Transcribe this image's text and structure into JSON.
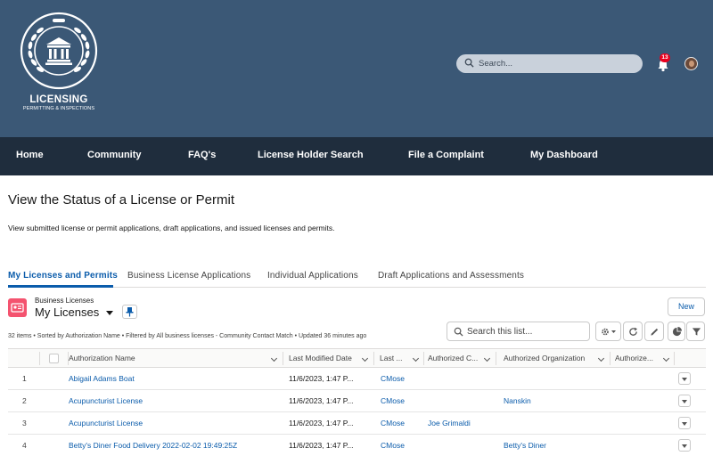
{
  "branding": {
    "title": "LICENSING",
    "subtitle": "PERMITTING & INSPECTIONS"
  },
  "header": {
    "search_placeholder": "Search...",
    "notification_count": "13"
  },
  "nav": {
    "items": [
      "Home",
      "Community",
      "FAQ's",
      "License Holder Search",
      "File a Complaint",
      "My Dashboard"
    ]
  },
  "page": {
    "title": "View the Status of a License or Permit",
    "description": "View submitted license or permit applications, draft applications, and issued licenses and permits."
  },
  "tabs": [
    "My Licenses and Permits",
    "Business License Applications",
    "Individual Applications",
    "Draft Applications and Assessments"
  ],
  "list_view": {
    "object_label": "Business Licenses",
    "name": "My Licenses",
    "new_label": "New",
    "meta": "32 items • Sorted by Authorization Name • Filtered by All business licenses - Community Contact Match • Updated 36 minutes ago",
    "search_placeholder": "Search this list..."
  },
  "table": {
    "columns": [
      "Authorization Name",
      "Last Modified Date",
      "Last ...",
      "Authorized C...",
      "Authorized Organization",
      "Authorize..."
    ],
    "rows": [
      {
        "num": "1",
        "name": "Abigail Adams Boat",
        "modified": "11/6/2023, 1:47 P...",
        "last": "CMose",
        "contact": "",
        "org": ""
      },
      {
        "num": "2",
        "name": "Acupuncturist License",
        "modified": "11/6/2023, 1:47 P...",
        "last": "CMose",
        "contact": "",
        "org": "Nanskin"
      },
      {
        "num": "3",
        "name": "Acupuncturist License",
        "modified": "11/6/2023, 1:47 P...",
        "last": "CMose",
        "contact": "Joe Grimaldi",
        "org": ""
      },
      {
        "num": "4",
        "name": "Betty's Diner Food Delivery 2022-02-02 19:49:25Z",
        "modified": "11/6/2023, 1:47 P...",
        "last": "CMose",
        "contact": "",
        "org": "Betty's Diner"
      }
    ]
  },
  "colors": {
    "header_bg": "#3b5876",
    "nav_bg": "#1f2d3d",
    "accent": "#0b5cab",
    "object_icon": "#f4536f",
    "badge": "#ea001e"
  }
}
